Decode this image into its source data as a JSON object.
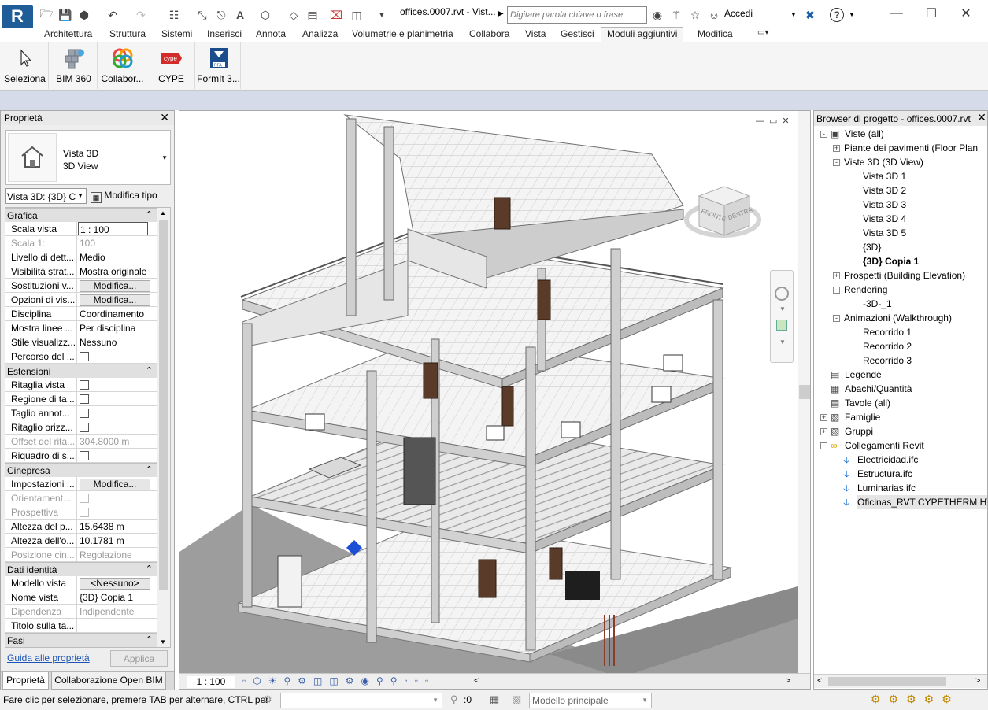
{
  "app": {
    "logo": "R",
    "document_title": "offices.0007.rvt - Vist...",
    "search_placeholder": "Digitare parola chiave o frase",
    "sign_in": "Accedi",
    "icons": [
      "open-icon",
      "save-icon",
      "sync-icon",
      "undo-icon",
      "redo-icon",
      "measure-icon",
      "dimension-icon",
      "tag-icon",
      "text-icon",
      "3d-view-icon",
      "section-icon",
      "thin-lines-icon",
      "close-hidden-icon",
      "switch-windows-icon",
      "dropdown-icon",
      "binoculars-icon",
      "subscription-icon",
      "star-icon",
      "user-icon",
      "exchange-icon",
      "help-icon",
      "minimize-icon",
      "maximize-icon",
      "close-icon"
    ]
  },
  "menu": {
    "tabs": [
      "Architettura",
      "Struttura",
      "Sistemi",
      "Inserisci",
      "Annota",
      "Analizza",
      "Volumetrie e planimetria",
      "Collabora",
      "Vista",
      "Gestisci",
      "Moduli aggiuntivi",
      "Modifica"
    ],
    "active_tab": "Moduli aggiuntivi"
  },
  "ribbon": {
    "buttons": [
      {
        "label": "Seleziona",
        "icon": "cursor-icon"
      },
      {
        "label": "BIM 360",
        "icon": "bim360-icon"
      },
      {
        "label": "Collabor...",
        "icon": "collaborate-icon"
      },
      {
        "label": "CYPE",
        "icon": "cype-icon"
      },
      {
        "label": "FormIt 3...",
        "icon": "formit-icon"
      }
    ]
  },
  "properties": {
    "title": "Proprietà",
    "type_name": "Vista 3D",
    "type_sub": "3D View",
    "selector": "Vista 3D: {3D} C",
    "edit_type": "Modifica tipo",
    "groups": [
      {
        "name": "Grafica",
        "rows": [
          {
            "k": "Scala vista",
            "v": "1 : 100",
            "kind": "input"
          },
          {
            "k": "Scala  1:",
            "v": "100",
            "kind": "text",
            "disabled": true
          },
          {
            "k": "Livello di dett...",
            "v": "Medio",
            "kind": "text"
          },
          {
            "k": "Visibilità strat...",
            "v": "Mostra originale",
            "kind": "text"
          },
          {
            "k": "Sostituzioni v...",
            "v": "Modifica...",
            "kind": "button"
          },
          {
            "k": "Opzioni di vis...",
            "v": "Modifica...",
            "kind": "button"
          },
          {
            "k": "Disciplina",
            "v": "Coordinamento",
            "kind": "text"
          },
          {
            "k": "Mostra linee ...",
            "v": "Per disciplina",
            "kind": "text"
          },
          {
            "k": "Stile visualizz...",
            "v": "Nessuno",
            "kind": "text"
          },
          {
            "k": "Percorso del ...",
            "v": "",
            "kind": "checkbox"
          }
        ]
      },
      {
        "name": "Estensioni",
        "rows": [
          {
            "k": "Ritaglia vista",
            "v": "",
            "kind": "checkbox"
          },
          {
            "k": "Regione di ta...",
            "v": "",
            "kind": "checkbox"
          },
          {
            "k": "Taglio annot...",
            "v": "",
            "kind": "checkbox"
          },
          {
            "k": "Ritaglio orizz...",
            "v": "",
            "kind": "checkbox"
          },
          {
            "k": "Offset del rita...",
            "v": "304.8000 m",
            "kind": "text",
            "disabled": true
          },
          {
            "k": "Riquadro di s...",
            "v": "",
            "kind": "checkbox"
          }
        ]
      },
      {
        "name": "Cinepresa",
        "rows": [
          {
            "k": "Impostazioni ...",
            "v": "Modifica...",
            "kind": "button"
          },
          {
            "k": "Orientament...",
            "v": "",
            "kind": "checkbox",
            "disabled": true
          },
          {
            "k": "Prospettiva",
            "v": "",
            "kind": "checkbox",
            "disabled": true
          },
          {
            "k": "Altezza del p...",
            "v": "15.6438 m",
            "kind": "text"
          },
          {
            "k": "Altezza dell'o...",
            "v": "10.1781 m",
            "kind": "text"
          },
          {
            "k": "Posizione cin...",
            "v": "Regolazione",
            "kind": "text",
            "disabled": true
          }
        ]
      },
      {
        "name": "Dati identità",
        "rows": [
          {
            "k": "Modello vista",
            "v": "<Nessuno>",
            "kind": "button"
          },
          {
            "k": "Nome vista",
            "v": "{3D} Copia 1",
            "kind": "text"
          },
          {
            "k": "Dipendenza",
            "v": "Indipendente",
            "kind": "text",
            "disabled": true
          },
          {
            "k": "Titolo sulla ta...",
            "v": "",
            "kind": "text"
          }
        ]
      },
      {
        "name": "Fasi",
        "rows": []
      }
    ],
    "help_link": "Guida alle proprietà",
    "apply": "Applica",
    "bottom_tabs": [
      "Proprietà",
      "Collaborazione Open BIM"
    ]
  },
  "viewport": {
    "viewcube_front": "FRONTE",
    "viewcube_right": "DESTRA",
    "scale": "1 : 100"
  },
  "browser": {
    "title": "Browser di progetto - offices.0007.rvt",
    "tree": [
      {
        "label": "Viste (all)",
        "level": 0,
        "expander": "-",
        "icon": "views-icon"
      },
      {
        "label": "Piante dei pavimenti (Floor Plan",
        "level": 1,
        "expander": "+"
      },
      {
        "label": "Viste 3D (3D View)",
        "level": 1,
        "expander": "-"
      },
      {
        "label": "Vista 3D 1",
        "level": 2
      },
      {
        "label": "Vista 3D 2",
        "level": 2
      },
      {
        "label": "Vista 3D 3",
        "level": 2
      },
      {
        "label": "Vista 3D 4",
        "level": 2
      },
      {
        "label": "Vista 3D 5",
        "level": 2
      },
      {
        "label": "{3D}",
        "level": 2
      },
      {
        "label": "{3D} Copia 1",
        "level": 2,
        "bold": true
      },
      {
        "label": "Prospetti (Building Elevation)",
        "level": 1,
        "expander": "+"
      },
      {
        "label": "Rendering",
        "level": 1,
        "expander": "-"
      },
      {
        "label": "-3D-_1",
        "level": 2
      },
      {
        "label": "Animazioni (Walkthrough)",
        "level": 1,
        "expander": "-"
      },
      {
        "label": "Recorrido 1",
        "level": 2
      },
      {
        "label": "Recorrido 2",
        "level": 2
      },
      {
        "label": "Recorrido 3",
        "level": 2
      },
      {
        "label": "Legende",
        "level": 0,
        "icon": "legend-icon"
      },
      {
        "label": "Abachi/Quantità",
        "level": 0,
        "icon": "schedule-icon"
      },
      {
        "label": "Tavole (all)",
        "level": 0,
        "icon": "sheet-icon"
      },
      {
        "label": "Famiglie",
        "level": 0,
        "expander": "+",
        "icon": "family-icon"
      },
      {
        "label": "Gruppi",
        "level": 0,
        "expander": "+",
        "icon": "group-icon"
      },
      {
        "label": "Collegamenti Revit",
        "level": 0,
        "expander": "-",
        "icon": "link-icon"
      },
      {
        "label": "Electricidad.ifc",
        "level": 1,
        "icon": "link-arrow-icon"
      },
      {
        "label": "Estructura.ifc",
        "level": 1,
        "icon": "link-arrow-icon"
      },
      {
        "label": "Luminarias.ifc",
        "level": 1,
        "icon": "link-arrow-icon"
      },
      {
        "label": "Oficinas_RVT CYPETHERM HV",
        "level": 1,
        "icon": "link-arrow-icon",
        "selected": true
      }
    ]
  },
  "statusbar": {
    "message": "Fare clic per selezionare, premere TAB per alternare, CTRL per",
    "count": ":0",
    "model": "Modello principale"
  }
}
